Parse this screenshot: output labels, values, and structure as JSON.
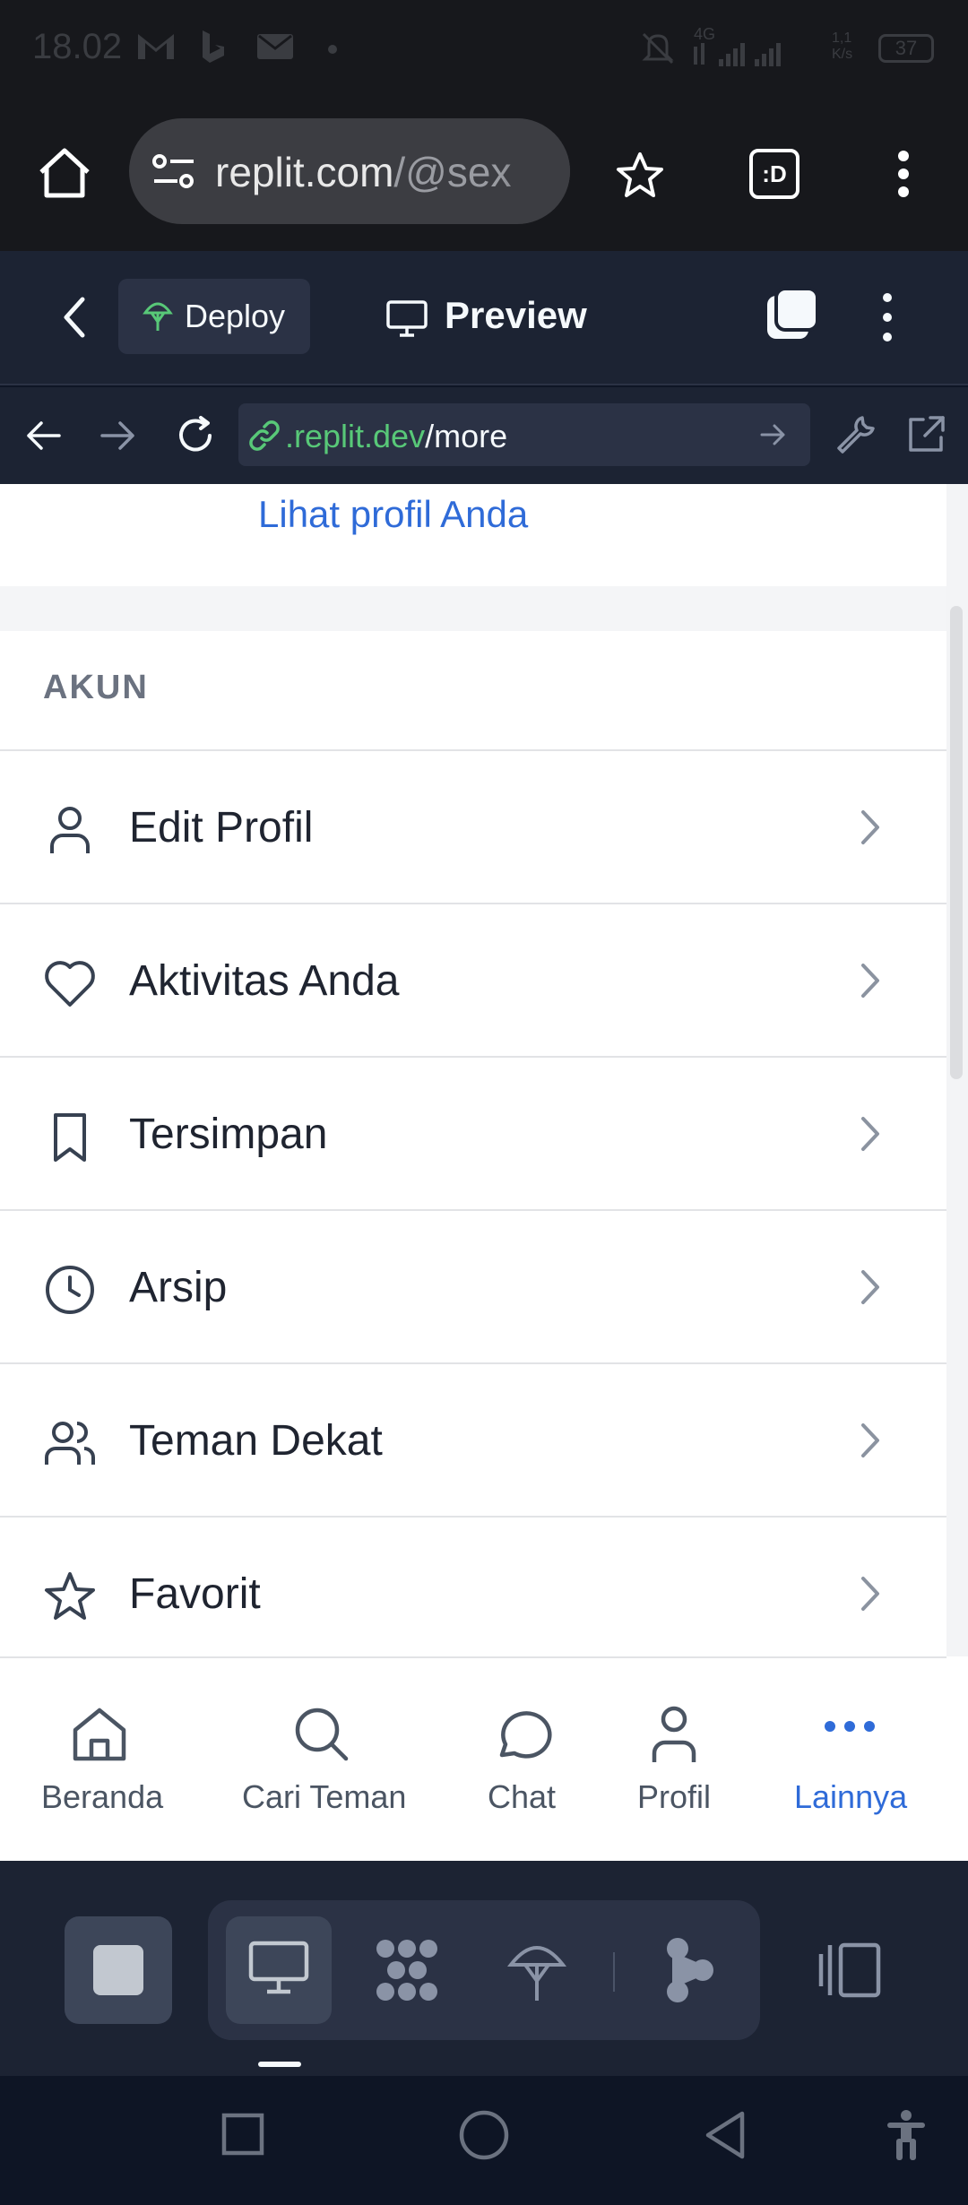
{
  "status_bar": {
    "time": "18.02",
    "battery": "37",
    "network": "4G",
    "speed": "1,1 K/s"
  },
  "browser": {
    "url_host": "replit.com",
    "url_path": "/@sex",
    "tab_count_badge": ":D"
  },
  "replit_header": {
    "deploy_label": "Deploy",
    "preview_label": "Preview"
  },
  "webview": {
    "url_host": ".replit.dev",
    "url_path": "/more"
  },
  "page": {
    "view_profile_link": "Lihat profil Anda",
    "section_title": "AKUN",
    "rows": [
      {
        "icon": "user-icon",
        "label": "Edit Profil"
      },
      {
        "icon": "heart-icon",
        "label": "Aktivitas Anda"
      },
      {
        "icon": "bookmark-icon",
        "label": "Tersimpan"
      },
      {
        "icon": "clock-icon",
        "label": "Arsip"
      },
      {
        "icon": "users-icon",
        "label": "Teman Dekat"
      },
      {
        "icon": "star-icon",
        "label": "Favorit"
      }
    ]
  },
  "bottom_nav": {
    "tabs": [
      {
        "icon": "home-icon",
        "label": "Beranda",
        "active": false
      },
      {
        "icon": "search-icon",
        "label": "Cari Teman",
        "active": false
      },
      {
        "icon": "chat-icon",
        "label": "Chat",
        "active": false
      },
      {
        "icon": "user-icon",
        "label": "Profil",
        "active": false
      },
      {
        "icon": "more-icon",
        "label": "Lainnya",
        "active": true
      }
    ]
  },
  "colors": {
    "accent": "#2f6bd8",
    "header_bg": "#1c2333",
    "link_green": "#58c878"
  }
}
